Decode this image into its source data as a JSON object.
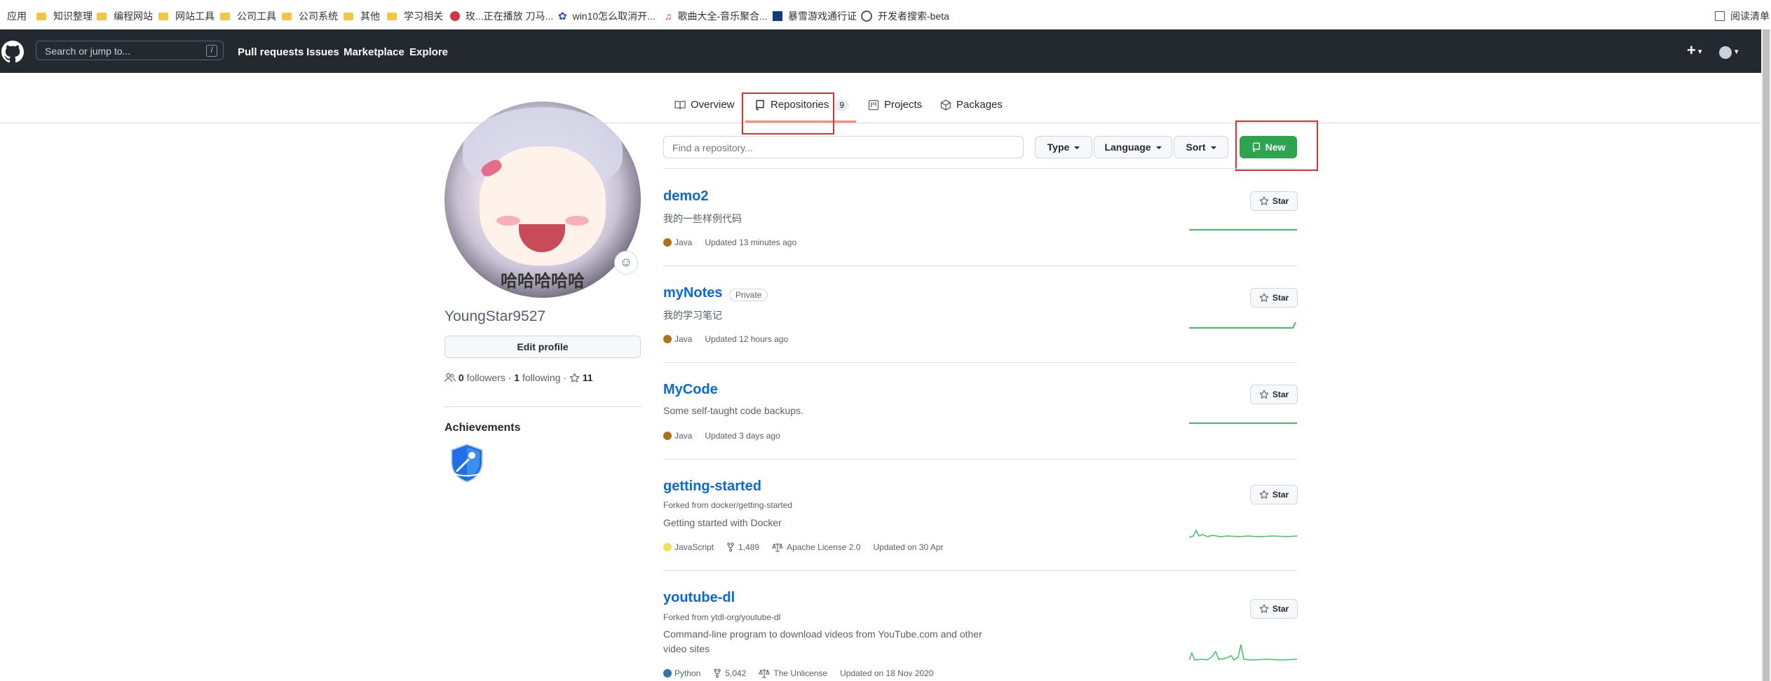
{
  "bookmarks": [
    "应用",
    "知识整理",
    "编程网站",
    "网站工具",
    "公司工具",
    "公司系统",
    "其他",
    "学习相关",
    "玫...正在播放 刀马...",
    "win10怎么取消开...",
    "歌曲大全-音乐聚合...",
    "暴雪游戏通行证",
    "开发者搜索-beta",
    "阅读清单"
  ],
  "header": {
    "search_placeholder": "Search or jump to...",
    "search_shortcut": "/",
    "nav": [
      "Pull requests",
      "Issues",
      "Marketplace",
      "Explore"
    ],
    "plus": "+",
    "caret": "▾"
  },
  "tabs": [
    {
      "label": "Overview",
      "icon": "book-icon"
    },
    {
      "label": "Repositories",
      "icon": "repo-icon",
      "count": "9"
    },
    {
      "label": "Projects",
      "icon": "project-icon"
    },
    {
      "label": "Packages",
      "icon": "package-icon"
    }
  ],
  "profile": {
    "avatar_caption": "哈哈哈哈哈",
    "username": "YoungStar9527",
    "edit_label": "Edit profile",
    "followers_count": "0",
    "followers_label": "followers",
    "following_count": "1",
    "following_label": "following",
    "stars_count": "11",
    "achievements_title": "Achievements"
  },
  "toolbar": {
    "find_placeholder": "Find a repository...",
    "type_label": "Type",
    "language_label": "Language",
    "sort_label": "Sort",
    "new_label": "New"
  },
  "repos": [
    {
      "name": "demo2",
      "description": "我的一些样例代码",
      "language": "Java",
      "lang_color": "#b07219",
      "updated": "Updated 13 minutes ago",
      "star_label": "Star"
    },
    {
      "name": "myNotes",
      "private_label": "Private",
      "description": "我的学习笔记",
      "language": "Java",
      "lang_color": "#b07219",
      "updated": "Updated 12 hours ago",
      "star_label": "Star"
    },
    {
      "name": "MyCode",
      "description": "Some self-taught code backups.",
      "language": "Java",
      "lang_color": "#b07219",
      "updated": "Updated 3 days ago",
      "star_label": "Star"
    },
    {
      "name": "getting-started",
      "fork_text": "Forked from docker/getting-started",
      "description": "Getting started with Docker",
      "language": "JavaScript",
      "lang_color": "#f1e05a",
      "forks": "1,489",
      "license": "Apache License 2.0",
      "updated": "Updated on 30 Apr",
      "star_label": "Star"
    },
    {
      "name": "youtube-dl",
      "fork_text": "Forked from ytdl-org/youtube-dl",
      "description_line1": "Command-line program to download videos from YouTube.com and other",
      "description_line2": "video sites",
      "language": "Python",
      "lang_color": "#3572a5",
      "forks": "5,042",
      "license": "The Unlicense",
      "updated": "Updated on 18 Nov 2020",
      "star_label": "Star"
    }
  ],
  "colors": {
    "accent_green": "#2da44e",
    "link_blue": "#0969da",
    "header_bg": "#24292f",
    "highlight_red": "#e03131"
  }
}
